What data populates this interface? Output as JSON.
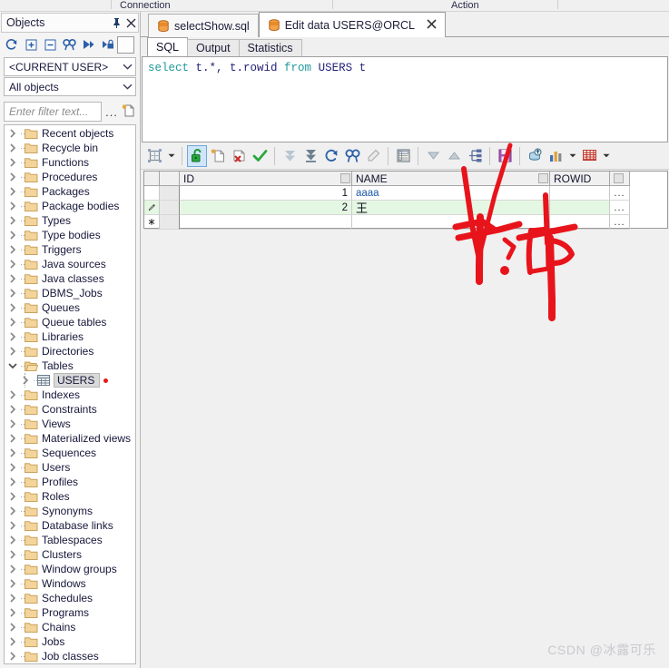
{
  "top_toolbar": {
    "groups": [
      {
        "label": "Connection"
      },
      {
        "label": "Action"
      }
    ]
  },
  "objects_panel": {
    "title": "Objects",
    "pin_icon": "pin-icon",
    "close_icon": "close-icon",
    "toolbar_icons": [
      "refresh-icon",
      "expand-all-icon",
      "collapse-all-icon",
      "find-icon",
      "filter-icon",
      "lock-filter-icon"
    ],
    "user_select": {
      "value": "<CURRENT USER>",
      "chevron": "chevron-down-icon"
    },
    "type_select": {
      "value": "All objects",
      "chevron": "chevron-down-icon"
    },
    "filter": {
      "placeholder": "Enter filter text...",
      "more_label": "...",
      "new_icon": "new-filter-icon"
    },
    "tree": [
      {
        "label": "Recent objects",
        "icon": "folder-icon",
        "expanded": false,
        "selected": false
      },
      {
        "label": "Recycle bin",
        "icon": "folder-icon",
        "expanded": false,
        "selected": false
      },
      {
        "label": "Functions",
        "icon": "folder-icon",
        "expanded": false,
        "selected": false
      },
      {
        "label": "Procedures",
        "icon": "folder-icon",
        "expanded": false,
        "selected": false
      },
      {
        "label": "Packages",
        "icon": "folder-icon",
        "expanded": false,
        "selected": false
      },
      {
        "label": "Package bodies",
        "icon": "folder-icon",
        "expanded": false,
        "selected": false
      },
      {
        "label": "Types",
        "icon": "folder-icon",
        "expanded": false,
        "selected": false
      },
      {
        "label": "Type bodies",
        "icon": "folder-icon",
        "expanded": false,
        "selected": false
      },
      {
        "label": "Triggers",
        "icon": "folder-icon",
        "expanded": false,
        "selected": false
      },
      {
        "label": "Java sources",
        "icon": "folder-icon",
        "expanded": false,
        "selected": false
      },
      {
        "label": "Java classes",
        "icon": "folder-icon",
        "expanded": false,
        "selected": false
      },
      {
        "label": "DBMS_Jobs",
        "icon": "folder-icon",
        "expanded": false,
        "selected": false
      },
      {
        "label": "Queues",
        "icon": "folder-icon",
        "expanded": false,
        "selected": false
      },
      {
        "label": "Queue tables",
        "icon": "folder-icon",
        "expanded": false,
        "selected": false
      },
      {
        "label": "Libraries",
        "icon": "folder-icon",
        "expanded": false,
        "selected": false
      },
      {
        "label": "Directories",
        "icon": "folder-icon",
        "expanded": false,
        "selected": false
      },
      {
        "label": "Tables",
        "icon": "folder-open-icon",
        "expanded": true,
        "selected": false
      },
      {
        "label": "USERS",
        "icon": "table-icon",
        "expanded": false,
        "selected": true,
        "child": true,
        "marker": true
      },
      {
        "label": "Indexes",
        "icon": "folder-icon",
        "expanded": false,
        "selected": false
      },
      {
        "label": "Constraints",
        "icon": "folder-icon",
        "expanded": false,
        "selected": false
      },
      {
        "label": "Views",
        "icon": "folder-icon",
        "expanded": false,
        "selected": false
      },
      {
        "label": "Materialized views",
        "icon": "folder-icon",
        "expanded": false,
        "selected": false
      },
      {
        "label": "Sequences",
        "icon": "folder-icon",
        "expanded": false,
        "selected": false
      },
      {
        "label": "Users",
        "icon": "folder-icon",
        "expanded": false,
        "selected": false
      },
      {
        "label": "Profiles",
        "icon": "folder-icon",
        "expanded": false,
        "selected": false
      },
      {
        "label": "Roles",
        "icon": "folder-icon",
        "expanded": false,
        "selected": false
      },
      {
        "label": "Synonyms",
        "icon": "folder-icon",
        "expanded": false,
        "selected": false
      },
      {
        "label": "Database links",
        "icon": "folder-icon",
        "expanded": false,
        "selected": false
      },
      {
        "label": "Tablespaces",
        "icon": "folder-icon",
        "expanded": false,
        "selected": false
      },
      {
        "label": "Clusters",
        "icon": "folder-icon",
        "expanded": false,
        "selected": false
      },
      {
        "label": "Window groups",
        "icon": "folder-icon",
        "expanded": false,
        "selected": false
      },
      {
        "label": "Windows",
        "icon": "folder-icon",
        "expanded": false,
        "selected": false
      },
      {
        "label": "Schedules",
        "icon": "folder-icon",
        "expanded": false,
        "selected": false
      },
      {
        "label": "Programs",
        "icon": "folder-icon",
        "expanded": false,
        "selected": false
      },
      {
        "label": "Chains",
        "icon": "folder-icon",
        "expanded": false,
        "selected": false
      },
      {
        "label": "Jobs",
        "icon": "folder-icon",
        "expanded": false,
        "selected": false
      },
      {
        "label": "Job classes",
        "icon": "folder-icon",
        "expanded": false,
        "selected": false
      }
    ]
  },
  "doc_tabs": [
    {
      "label": "selectShow.sql",
      "icon": "database-icon",
      "active": false,
      "closable": false
    },
    {
      "label": "Edit data USERS@ORCL",
      "icon": "database-icon",
      "active": true,
      "closable": true,
      "close_icon": "close-icon"
    }
  ],
  "inner_tabs": [
    {
      "label": "SQL",
      "active": true
    },
    {
      "label": "Output",
      "active": false
    },
    {
      "label": "Statistics",
      "active": false
    }
  ],
  "sql_editor": {
    "tokens": [
      {
        "text": "select",
        "type": "keyword"
      },
      {
        "text": " t.*, t.rowid ",
        "type": "identifier"
      },
      {
        "text": "from",
        "type": "keyword"
      },
      {
        "text": " USERS t",
        "type": "identifier"
      }
    ],
    "full_text": "select t.*, t.rowid from USERS t"
  },
  "grid_toolbar": {
    "buttons": [
      {
        "name": "select-mode-icon",
        "caret": true,
        "framed": false
      },
      {
        "name": "unlock-edit-icon",
        "caret": false,
        "framed": true
      },
      {
        "name": "insert-record-icon",
        "caret": false,
        "framed": false
      },
      {
        "name": "delete-record-icon",
        "caret": false,
        "framed": false
      },
      {
        "name": "post-changes-icon",
        "caret": false,
        "framed": false
      },
      {
        "name": "fetch-next-page-icon",
        "caret": false,
        "framed": false
      },
      {
        "name": "fetch-last-page-icon",
        "caret": false,
        "framed": false
      },
      {
        "name": "refresh-icon",
        "caret": false,
        "framed": false
      },
      {
        "name": "find-icon",
        "caret": false,
        "framed": false
      },
      {
        "name": "clear-icon",
        "caret": false,
        "framed": false
      },
      {
        "name": "single-record-view-icon",
        "caret": false,
        "framed": false
      },
      {
        "name": "sort-descending-icon",
        "caret": false,
        "framed": false
      },
      {
        "name": "sort-ascending-icon",
        "caret": false,
        "framed": false
      },
      {
        "name": "hierarchy-icon",
        "caret": false,
        "framed": false
      },
      {
        "name": "save-icon",
        "caret": false,
        "framed": false
      },
      {
        "name": "export-query-icon",
        "caret": false,
        "framed": false
      },
      {
        "name": "chart-icon",
        "caret": true,
        "framed": false
      },
      {
        "name": "grid-options-icon",
        "caret": true,
        "framed": false
      }
    ]
  },
  "data_grid": {
    "columns": [
      {
        "label": "ID",
        "align": "right"
      },
      {
        "label": "NAME",
        "align": "left"
      },
      {
        "label": "ROWID",
        "align": "left"
      }
    ],
    "rows": [
      {
        "indicator": "",
        "id": "1",
        "name": "aaaa",
        "rowid": "",
        "more": "...",
        "state": "normal"
      },
      {
        "indicator": "edit-pencil-icon",
        "id": "2",
        "name": "王",
        "rowid": "",
        "more": "...",
        "state": "editing"
      },
      {
        "indicator": "new-row-asterisk-icon",
        "id": "",
        "name": "",
        "rowid": "",
        "more": "...",
        "state": "new"
      }
    ]
  },
  "annotation": {
    "type": "handwritten-red-ink",
    "strokes": "checkmark-and-chinese-characters",
    "text": "乱码"
  },
  "watermark": {
    "text": "CSDN @冰露可乐"
  },
  "colors": {
    "accent_blue": "#2b5fa8",
    "tab_icon_orange": "#e07a1f",
    "sql_keyword": "#1f9a9a",
    "sql_identifier": "#22227a",
    "edit_row_green": "#e4f7e2",
    "ink_red": "#e8141b",
    "marker_red": "#e41a1a"
  }
}
